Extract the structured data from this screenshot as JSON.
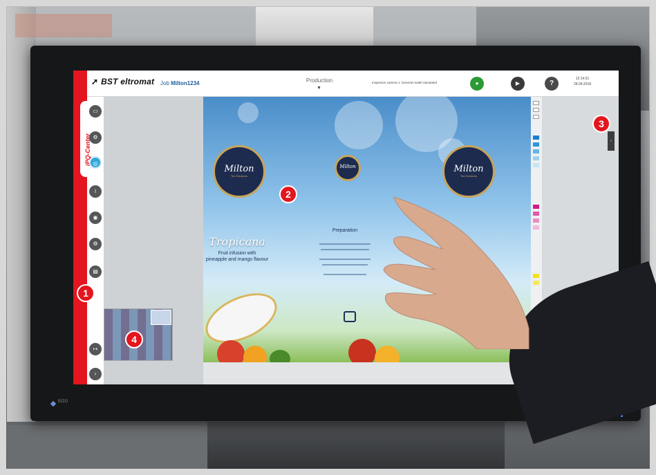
{
  "header": {
    "brand": "BST eltromat",
    "brand_sub": "",
    "job_prefix": "Job",
    "job_name": "Milton1234",
    "mode": "Production",
    "status_message": "Inspection camera 1: General model calculated",
    "clock_time": "12:14:31",
    "clock_date": "28.04.2018"
  },
  "sidebar": {
    "tab_label": "iPQ-Center",
    "buttons": [
      "monitor-icon",
      "settings-icon",
      "target-icon",
      "info-icon",
      "camera-icon",
      "settings-icon",
      "chat-icon",
      "exit-icon",
      "next-icon"
    ]
  },
  "artwork": {
    "badge_script": "Milton",
    "badge_sub": "Tea Solutions",
    "product_name": "Tropicana",
    "product_desc_line1": "Fruit infusion with",
    "product_desc_line2": "pineapple and mango flavour",
    "prep_title": "Preparation"
  },
  "callouts": [
    "1",
    "2",
    "3",
    "4"
  ],
  "colors": {
    "accent_red": "#e3151e",
    "status_green": "#2c9b35",
    "active_blue": "#34a6d8"
  },
  "monitor": {
    "brand": "EIZO"
  }
}
